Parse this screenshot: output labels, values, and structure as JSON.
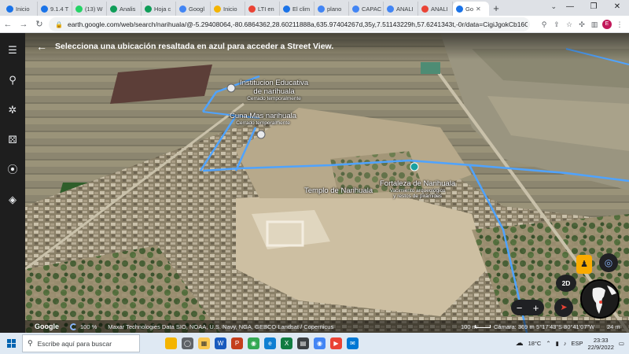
{
  "browser": {
    "tabs": [
      {
        "label": "Inicio",
        "color": "#1a73e8"
      },
      {
        "label": "9.1.4 T",
        "color": "#1a73e8"
      },
      {
        "label": "(13) W",
        "color": "#25d366"
      },
      {
        "label": "Analis",
        "color": "#0f9d58"
      },
      {
        "label": "Hoja c",
        "color": "#0f9d58"
      },
      {
        "label": "Googl",
        "color": "#4285f4"
      },
      {
        "label": "Inicio",
        "color": "#f4b400"
      },
      {
        "label": "LTI en",
        "color": "#ea4335"
      },
      {
        "label": "El clim",
        "color": "#1a73e8"
      },
      {
        "label": "plano",
        "color": "#4285f4"
      },
      {
        "label": "CAPAC",
        "color": "#4285f4"
      },
      {
        "label": "ANALI",
        "color": "#4285f4"
      },
      {
        "label": "ANALI",
        "color": "#ea4335"
      },
      {
        "label": "Go",
        "color": "#1a73e8"
      }
    ],
    "new_tab": "+",
    "window_controls": {
      "minimize": "—",
      "restore": "❐",
      "close": "✕"
    },
    "tab_search": "⌄",
    "url": "earth.google.com/web/search/narihuala/@-5.29408064,-80.6864362,28.60211888a,635.97404267d,35y,7.51143229h,57.6241343t,-0r/data=CigiJgokCb16OHu85hT...",
    "avatar_initial": "E"
  },
  "earth": {
    "streetview_message": "Selecciona una ubicación resaltada en azul para acceder a Street View.",
    "places": [
      {
        "name": "Institucion Educativa",
        "name2": "de narihuala",
        "sub": "Cerrado temporalmente"
      },
      {
        "name": "Cuna Mas narihuala",
        "sub": "Cerrado temporalmente"
      },
      {
        "name": "Templo de Narihuala"
      },
      {
        "name": "Fortaleza de Narihuala",
        "sub": "Vacimiento arqueológico",
        "sub2": "y restos de pirámides"
      }
    ],
    "controls": {
      "btn_2d": "2D",
      "zoom_out": "−",
      "zoom_in": "+"
    },
    "status": {
      "brand": "Google",
      "zoom": "100 %",
      "attribution": "Maxar Technologies  Data SIO, NOAA, U.S. Navy, NGA, GEBCO  Landsat / Copernicus",
      "scale": "100 m",
      "camera": "Cámara: 369 m",
      "coords": "5°17'43\"S 80°41'07\"W",
      "altitude": "24 m"
    }
  },
  "taskbar": {
    "search_placeholder": "Escribe aquí para buscar",
    "weather": "18°C",
    "language": "ESP",
    "time": "23:33",
    "date": "22/9/2022"
  }
}
